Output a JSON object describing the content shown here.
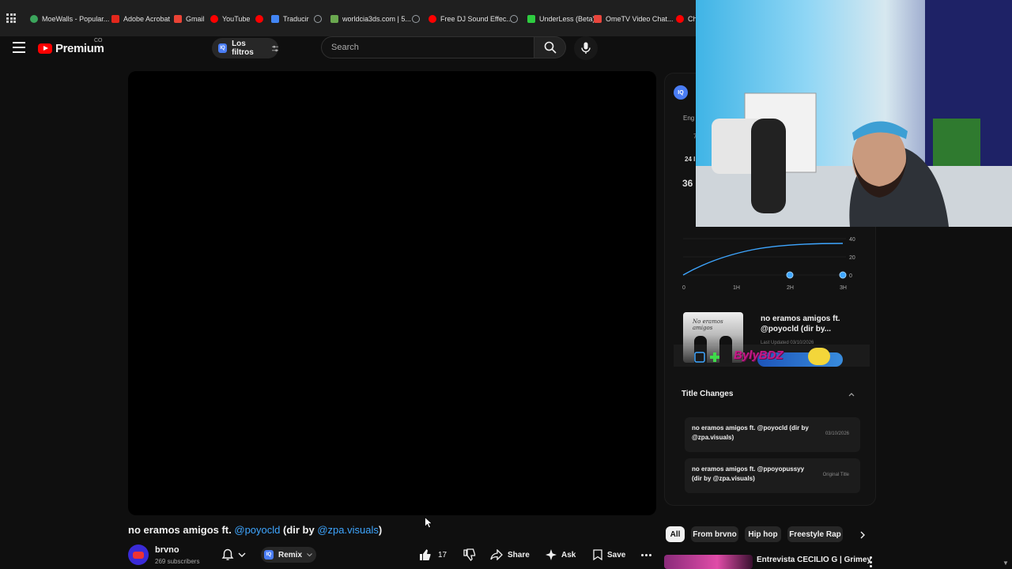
{
  "bookmarks": [
    {
      "label": "MoeWalls - Popular...",
      "color": "#3ba55c"
    },
    {
      "label": "Adobe Acrobat",
      "color": "#e3271c"
    },
    {
      "label": "Gmail",
      "color": "#ea4335"
    },
    {
      "label": "YouTube",
      "color": "#ff0000"
    },
    {
      "label": "",
      "color": "#ff0000"
    },
    {
      "label": "Traducir",
      "color": "#4285f4"
    },
    {
      "label": "",
      "color": "#9aa0a6"
    },
    {
      "label": "worldcia3ds.com | 5...",
      "color": "#6aa84f"
    },
    {
      "label": "",
      "color": "#9aa0a6"
    },
    {
      "label": "Free DJ Sound Effec...",
      "color": "#ff0000"
    },
    {
      "label": "",
      "color": "#9aa0a6"
    },
    {
      "label": "UnderLess (Beta)",
      "color": "#2ecc40"
    },
    {
      "label": "OmeTV Video Chat...",
      "color": "#e8453c"
    },
    {
      "label": "Ch",
      "color": "#ff0000"
    }
  ],
  "header": {
    "brand": "Premium",
    "country_code": "CO",
    "filters_label": "Los filtros",
    "search_placeholder": "Search"
  },
  "video": {
    "title_prefix": "no eramos amigos ft. ",
    "title_mention1": "@poyocld",
    "title_mid": " (dir by ",
    "title_mention2": "@zpa.visuals",
    "title_suffix": ")",
    "channel": "brvno",
    "subscribers": "269 subscribers",
    "remix_label": "Remix",
    "likes": "17",
    "share_label": "Share",
    "ask_label": "Ask",
    "save_label": "Save"
  },
  "side_panel": {
    "badge": "IQ",
    "peek_label": "Eng",
    "peek_7": "7",
    "stat_24": "24 I",
    "stat_36": "36",
    "chart": {
      "type": "line",
      "x_ticks": [
        "0",
        "1H",
        "2H",
        "3H"
      ],
      "y_ticks": [
        "40",
        "20",
        "0"
      ]
    },
    "thumb_caption": "No eramos amigos",
    "thumb_title": "no eramos amigos ft. @poyocld (dir by...",
    "last_updated": "Last Updated 03/10/2026",
    "sticker_name": "BylyBDZ",
    "title_changes_heading": "Title Changes",
    "title_changes": [
      {
        "title": "no eramos amigos ft. @poyocld (dir by @zpa.visuals)",
        "date": "03/10/2026"
      },
      {
        "title": "no eramos amigos ft. @ppoyopussyy (dir by @zpa.visuals)",
        "date": "Original Title"
      }
    ]
  },
  "chips": [
    "All",
    "From brvno",
    "Hip hop",
    "Freestyle Rap"
  ],
  "recommendation": {
    "title": "Entrevista CECILIO G | Grimey"
  },
  "colors": {
    "background": "#0f0f0f",
    "accent_blue": "#3ea6ff",
    "brand_red": "#ff0000",
    "chart_line": "#3ea6ff"
  }
}
